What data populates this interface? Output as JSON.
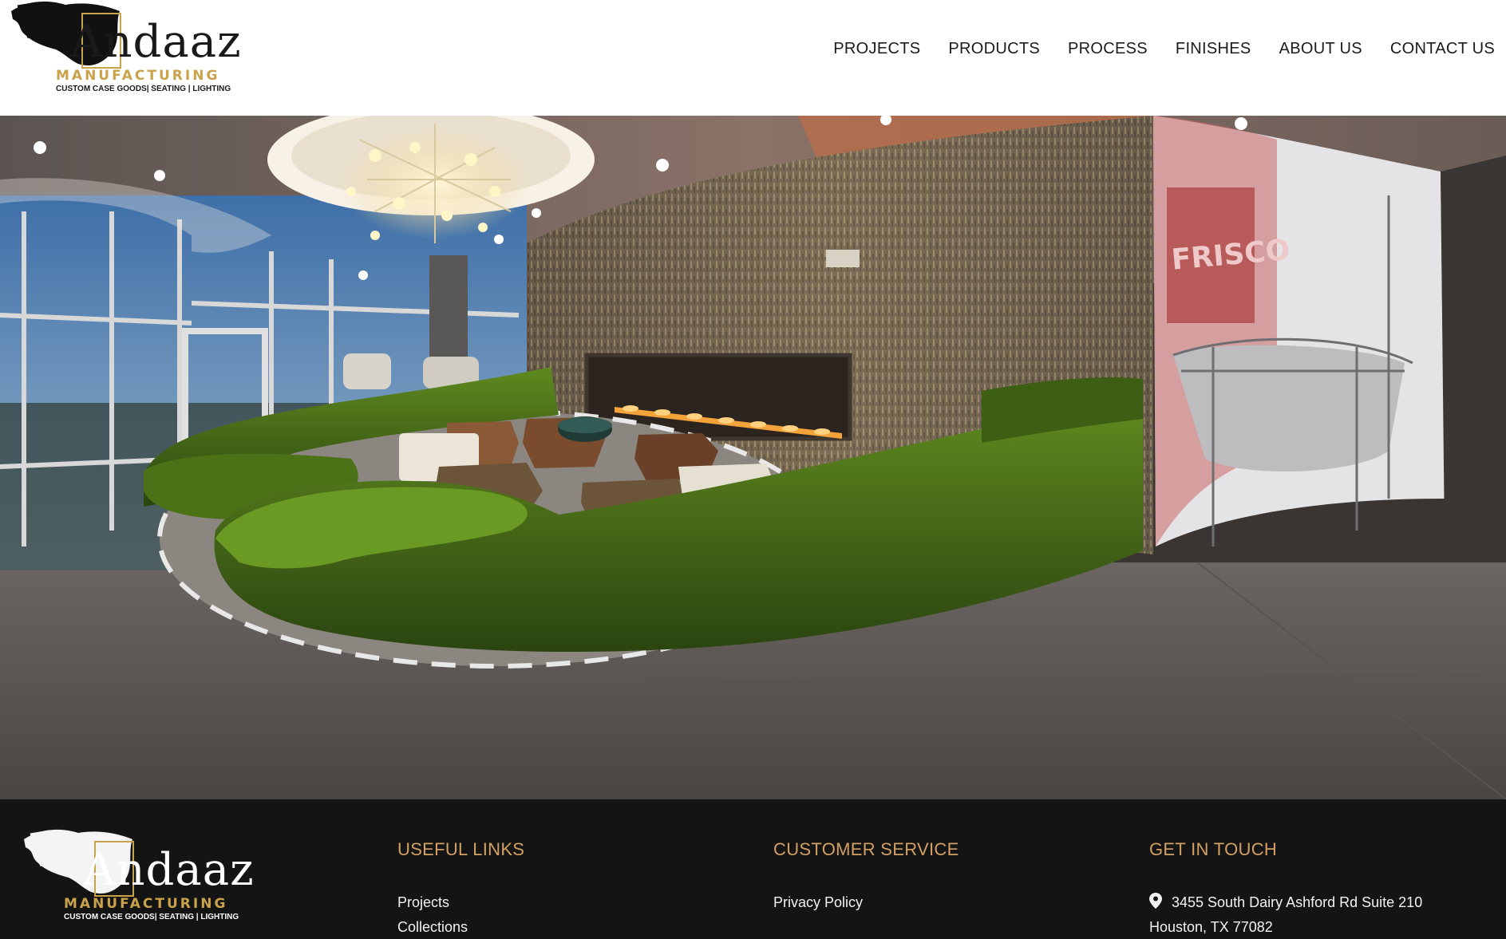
{
  "brand": {
    "name": "Andaaz",
    "sub": "MANUFACTURING",
    "tagline": "CUSTOM CASE GOODS| SEATING | LIGHTING",
    "accent": "#c9a24a"
  },
  "nav": {
    "items": [
      "PROJECTS",
      "PRODUCTS",
      "PROCESS",
      "FINISHES",
      "ABOUT US",
      "CONTACT US"
    ]
  },
  "hero": {
    "image": "hotel-lobby-green-sofa-fireplace",
    "mural_text": "FRISCO"
  },
  "footer": {
    "useful_links": {
      "title": "USEFUL LINKS",
      "links": [
        "Projects",
        "Collections"
      ]
    },
    "customer_service": {
      "title": "CUSTOMER SERVICE",
      "links": [
        "Privacy Policy"
      ]
    },
    "get_in_touch": {
      "title": "GET IN TOUCH",
      "address_line1": "3455 South Dairy Ashford Rd Suite 210",
      "address_line2": "Houston, TX 77082",
      "icon": "map-pin-icon"
    },
    "title_color": "#d1a062",
    "background": "#141414"
  }
}
